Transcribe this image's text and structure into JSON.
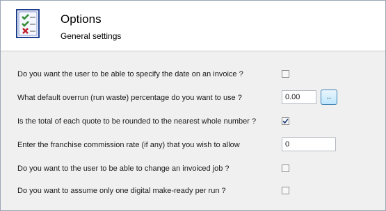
{
  "header": {
    "title": "Options",
    "subtitle": "General settings",
    "icon": "checklist-icon"
  },
  "settings": [
    {
      "question": "Do you want the user to be able to specify the date on an invoice ?",
      "control": "checkbox",
      "checked": false
    },
    {
      "question": "What default overrun (run waste) percentage do you want to use ?",
      "control": "text-with-button",
      "value": "0.00",
      "button_label": ".."
    },
    {
      "question": "Is the total of each quote to be rounded to the nearest whole number ?",
      "control": "checkbox",
      "checked": true
    },
    {
      "question": "Enter the franchise commission rate (if any) that you wish to allow",
      "control": "text",
      "value": "0"
    },
    {
      "question": "Do you want to the user to be able to change an invoiced job ?",
      "control": "checkbox",
      "checked": false
    },
    {
      "question": "Do you want to assume only one digital make-ready per run ?",
      "control": "checkbox",
      "checked": false
    }
  ],
  "colors": {
    "header_bg": "#ffffff",
    "panel_bg": "#f0f0f0",
    "check_green": "#2e8b2e",
    "cross_red": "#c0202a"
  }
}
